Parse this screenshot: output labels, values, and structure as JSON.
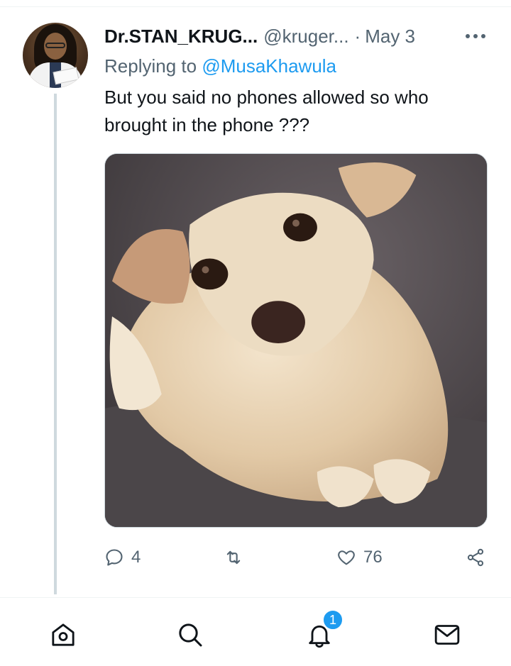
{
  "tweet": {
    "display_name": "Dr.STAN_KRUG...",
    "handle": "@kruger...",
    "separator": "·",
    "date": "May 3",
    "replying_prefix": "Replying to",
    "replying_to": "@MusaKhawula",
    "text": "But you said no phones allowed so who brought in the phone ???",
    "media_icon": "photo-dog-meme",
    "actions": {
      "reply_count": "4",
      "retweet_count": "",
      "like_count": "76"
    }
  },
  "bottom_nav": {
    "items": [
      {
        "icon": "home-icon"
      },
      {
        "icon": "search-icon"
      },
      {
        "icon": "notifications-icon",
        "badge": "1"
      },
      {
        "icon": "messages-icon"
      }
    ]
  },
  "colors": {
    "accent": "#1d9bf0",
    "muted": "#536471",
    "text": "#0f1419",
    "thread_line": "#cfd9de"
  }
}
